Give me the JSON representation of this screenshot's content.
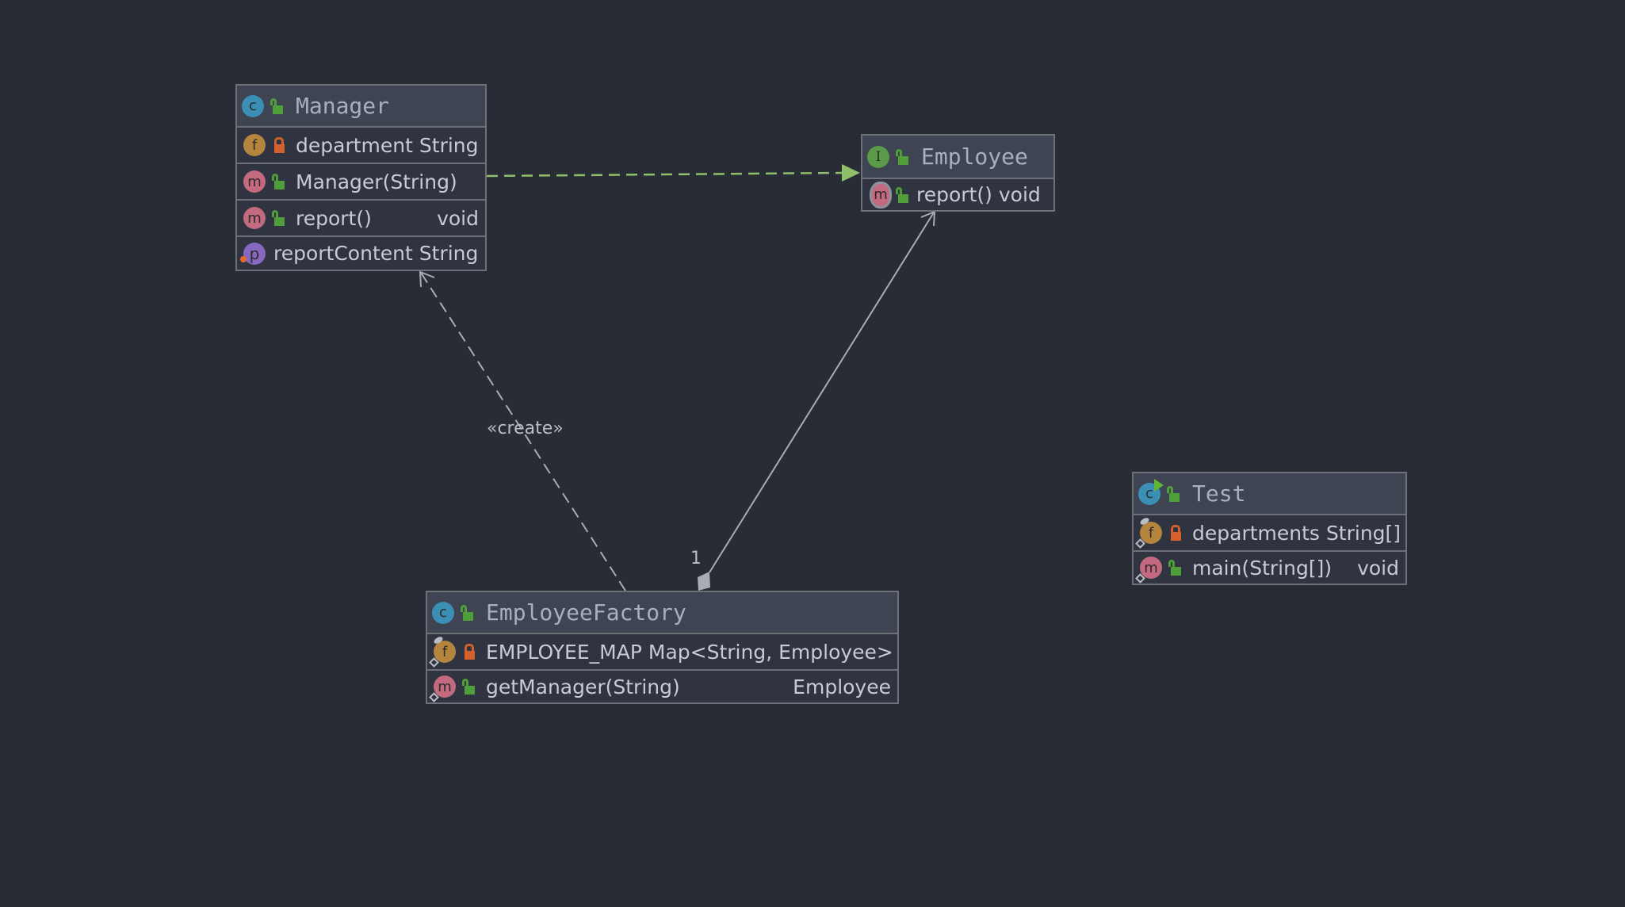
{
  "diagram": {
    "type": "UML class diagram",
    "nodes": [
      {
        "id": "manager",
        "kind": "class",
        "kind_icon": "class-icon",
        "kind_letter": "c",
        "visibility": "public",
        "name": "Manager",
        "members": [
          {
            "kind": "field",
            "letter": "f",
            "visibility": "private",
            "name": "department",
            "type": "String",
            "type_align": "inline"
          },
          {
            "kind": "method",
            "letter": "m",
            "visibility": "public",
            "name": "Manager(String)",
            "type": ""
          },
          {
            "kind": "method",
            "letter": "m",
            "visibility": "public",
            "name": "report()",
            "type": "void"
          },
          {
            "kind": "property",
            "letter": "p",
            "visibility": "",
            "name": "reportContent",
            "type": "String",
            "type_align": "inline"
          }
        ]
      },
      {
        "id": "employee",
        "kind": "interface",
        "kind_icon": "interface-icon",
        "kind_letter": "I",
        "visibility": "public",
        "name": "Employee",
        "members": [
          {
            "kind": "abstract-method",
            "letter": "m",
            "visibility": "public",
            "name": "report()",
            "type": "void",
            "type_align": "inline"
          }
        ]
      },
      {
        "id": "employee-factory",
        "kind": "class",
        "kind_icon": "class-icon",
        "kind_letter": "c",
        "visibility": "public",
        "name": "EmployeeFactory",
        "members": [
          {
            "kind": "static-final-field",
            "letter": "f",
            "visibility": "private",
            "name": "EMPLOYEE_MAP",
            "type": "Map<String, Employee>",
            "type_align": "inline"
          },
          {
            "kind": "static-method",
            "letter": "m",
            "visibility": "public",
            "name": "getManager(String)",
            "type": "Employee"
          }
        ]
      },
      {
        "id": "test",
        "kind": "runnable-class",
        "kind_icon": "runnable-class-icon",
        "kind_letter": "c",
        "visibility": "public",
        "name": "Test",
        "members": [
          {
            "kind": "static-final-field",
            "letter": "f",
            "visibility": "private",
            "name": "departments",
            "type": "String[]",
            "type_align": "inline"
          },
          {
            "kind": "static-method",
            "letter": "m",
            "visibility": "public",
            "name": "main(String[])",
            "type": "void"
          }
        ]
      }
    ],
    "edges": [
      {
        "id": "realization",
        "from": "Manager",
        "to": "Employee",
        "style": "dashed",
        "head": "filled-triangle",
        "color": "#8fbf6a",
        "label": ""
      },
      {
        "id": "create-dependency",
        "from": "EmployeeFactory",
        "to": "Manager",
        "style": "dashed",
        "head": "open-arrow",
        "color": "#a7acb5",
        "label": "«create»"
      },
      {
        "id": "composition",
        "from": "EmployeeFactory",
        "to": "Employee",
        "style": "solid",
        "head": "open-arrow",
        "tail": "filled-diamond",
        "color": "#a7acb5",
        "source_multiplicity": "1",
        "target_multiplicity": "*"
      }
    ]
  },
  "colors": {
    "canvas": "#282c35",
    "header": "#3e4452",
    "body": "#2f3440",
    "border": "#6d7076",
    "class_icon": "#3b8fb5",
    "interface_icon": "#5a9a48",
    "field_icon": "#b5853e",
    "method_icon": "#c46a80",
    "property_icon": "#8767c0",
    "public": "#4f9e3a",
    "private": "#d4602d"
  }
}
